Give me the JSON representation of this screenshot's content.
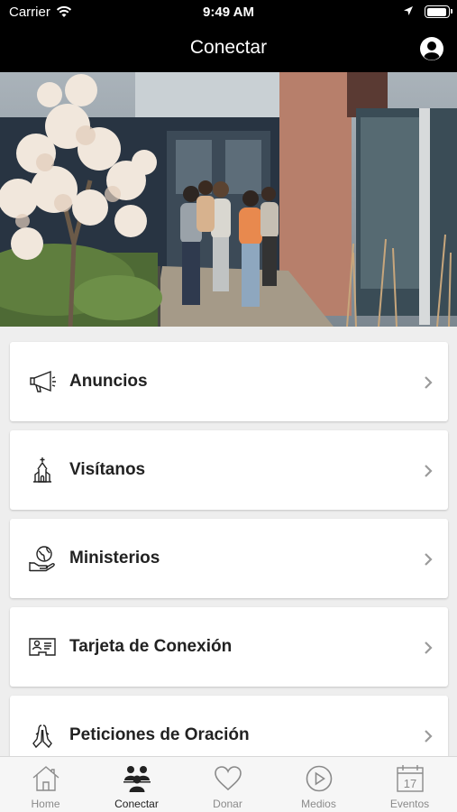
{
  "status_bar": {
    "carrier": "Carrier",
    "time": "9:49 AM"
  },
  "nav": {
    "title": "Conectar"
  },
  "menu": [
    {
      "label": "Anuncios",
      "icon": "megaphone-icon"
    },
    {
      "label": "Visítanos",
      "icon": "church-icon"
    },
    {
      "label": "Ministerios",
      "icon": "globe-hand-icon"
    },
    {
      "label": "Tarjeta de Conexión",
      "icon": "id-card-icon"
    },
    {
      "label": "Peticiones de Oración",
      "icon": "praying-hands-icon"
    }
  ],
  "tabs": [
    {
      "label": "Home",
      "icon": "home-icon"
    },
    {
      "label": "Conectar",
      "icon": "people-icon",
      "active": true
    },
    {
      "label": "Donar",
      "icon": "heart-icon"
    },
    {
      "label": "Medios",
      "icon": "play-icon"
    },
    {
      "label": "Eventos",
      "icon": "calendar-icon"
    }
  ],
  "calendar_day": "17",
  "colors": {
    "bar": "#000000",
    "background": "#eeeeee",
    "card": "#ffffff",
    "tab_inactive": "#8a8a8a"
  }
}
